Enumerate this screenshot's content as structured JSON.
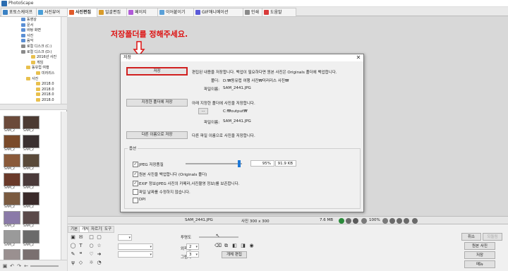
{
  "app": {
    "title": "PhotoScape"
  },
  "tabs": [
    {
      "label": "포토스케이프",
      "color": "#3b82c4",
      "active": false
    },
    {
      "label": "사진뷰어",
      "color": "#4a9fd8",
      "active": false
    },
    {
      "label": "사진편집",
      "color": "#e05a2a",
      "active": true
    },
    {
      "label": "일괄편집",
      "color": "#d89b2a",
      "active": false
    },
    {
      "label": "페이지",
      "color": "#b05ad8",
      "active": false
    },
    {
      "label": "이어붙이기",
      "color": "#5aa0d8",
      "active": false
    },
    {
      "label": "GIF애니메이션",
      "color": "#5a5ad8",
      "active": false
    },
    {
      "label": "인쇄",
      "color": "#8a8a8a",
      "active": false
    },
    {
      "label": "도움말",
      "color": "#d83a3a",
      "active": false
    }
  ],
  "tree": [
    {
      "label": "동영상",
      "type": "blue"
    },
    {
      "label": "문서",
      "type": "blue"
    },
    {
      "label": "바탕 화면",
      "type": "blue"
    },
    {
      "label": "사진",
      "type": "blue"
    },
    {
      "label": "음악",
      "type": "blue"
    },
    {
      "label": "로컬 디스크 (C:)",
      "type": "disk"
    },
    {
      "label": "로컬 디스크 (D:)",
      "type": "disk"
    },
    {
      "label": "2016년 사진",
      "type": "folder"
    },
    {
      "label": "게임",
      "type": "folder"
    },
    {
      "label": "동유럽 여행",
      "type": "folder"
    },
    {
      "label": "미러리스",
      "type": "folder"
    },
    {
      "label": "사진",
      "type": "folder"
    },
    {
      "label": "2018.0",
      "type": "folder"
    },
    {
      "label": "2018.0",
      "type": "folder"
    },
    {
      "label": "2018.0",
      "type": "folder"
    },
    {
      "label": "2018.0",
      "type": "folder"
    }
  ],
  "thumbnails": [
    {
      "caption": "SAM_2",
      "color": "#6b4a3a"
    },
    {
      "caption": "SAM_2",
      "color": "#4b3a32"
    },
    {
      "caption": "SAM_2",
      "color": "#7a4a2a"
    },
    {
      "caption": "SAM_2",
      "color": "#3a3030"
    },
    {
      "caption": "SAM_2",
      "color": "#8a5a3a"
    },
    {
      "caption": "SAM_2",
      "color": "#5a4a3a"
    },
    {
      "caption": "SAM_2",
      "color": "#6a3a2a"
    },
    {
      "caption": "SAM_2",
      "color": "#4a3a3a"
    },
    {
      "caption": "SAM_2",
      "color": "#7a5a40"
    },
    {
      "caption": "SAM_2",
      "color": "#3a2a2a"
    },
    {
      "caption": "SAM_2",
      "color": "#8a7aa8"
    },
    {
      "caption": "SAM_2",
      "color": "#5a4a4a"
    },
    {
      "caption": "SAM_2",
      "color": "#9a9a9a"
    },
    {
      "caption": "SAM_2",
      "color": "#6a6a6a"
    },
    {
      "caption": "SAM_2",
      "color": "#9a9090"
    },
    {
      "caption": "SAM_2",
      "color": "#7a7070"
    }
  ],
  "hint": "저장폴더를 정해주세요.",
  "dialog": {
    "title": "저장",
    "close": "✕",
    "save_button": "저장",
    "save_desc": "편집된 내용을 저장합니다. 백업이 필요하다면 원본 사진은 Originals 폴더에 백업합니다.",
    "folder_label": "폴더:",
    "folder_value": "D:₩동유럽 여행 사진₩미러리스 사진₩",
    "filename_label": "파일이름:",
    "filename_value": "SAM_2441.JPG",
    "save_to_folder_button": "지정한 폴더에 저장",
    "save_to_folder_desc": "아래 지정한 폴더에 사진을 저장합니다.",
    "browse_button": "...",
    "output_path": "C:₩output₩",
    "filename_label2": "파일이름:",
    "filename_value2": "SAM_2441.JPG",
    "save_as_button": "다른 이름으로 저장",
    "save_as_desc": "다른 파일 이름으로 사진을 저장합니다.",
    "options_label": "옵션",
    "options": [
      {
        "label": "JPEG 저장품질",
        "checked": true
      },
      {
        "label": "원본 사진을 백업합니다 (Originals 폴더)",
        "checked": true
      },
      {
        "label": "EXIF 정보(JPEG 사진의 카메라,사진촬영 정보)를 보존합니다.",
        "checked": true
      },
      {
        "label": "파일 날짜를 수정하지 않습니다.",
        "checked": false
      },
      {
        "label": "DPI",
        "checked": false
      }
    ],
    "quality_percent": "95%",
    "quality_value": 95,
    "file_size": "91.9 KB"
  },
  "status": {
    "filename": "SAM_2441.JPG",
    "dimensions": "사진 300 x 300",
    "size": "7.6 MB",
    "zoom": "100%"
  },
  "bottom": {
    "tabs": [
      "기본",
      "개체",
      "자르기",
      "도구"
    ],
    "active_tab": 1,
    "labels": {
      "opacity": "투명도",
      "outline": "외곽선",
      "shadow": "그림자"
    },
    "outline_value": "2",
    "shadow_value": "3",
    "object_edit_button": "개체 편집",
    "right_buttons": [
      {
        "label": "취소",
        "enabled": true
      },
      {
        "label": "되돌림",
        "enabled": false
      },
      {
        "label": "원본 사진",
        "enabled": true
      },
      {
        "label": "저장",
        "enabled": true
      },
      {
        "label": "메뉴",
        "enabled": true
      }
    ]
  }
}
